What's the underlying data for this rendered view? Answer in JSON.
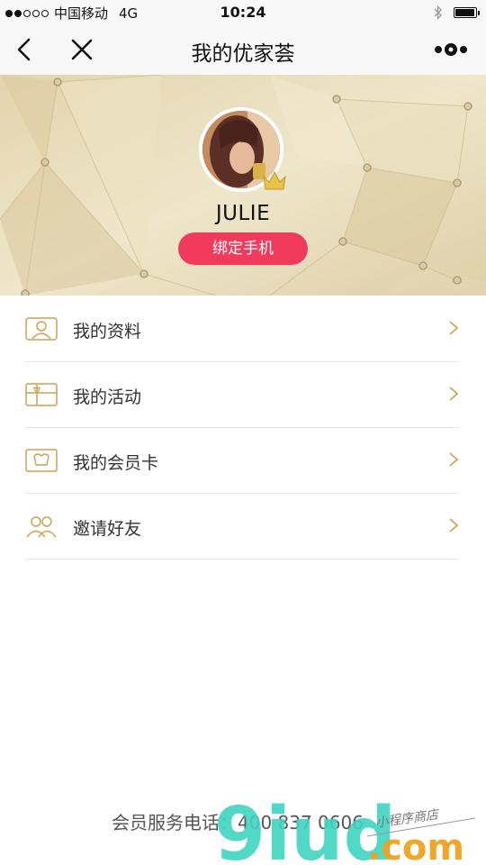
{
  "status_bar": {
    "signal": [
      true,
      true,
      false,
      false,
      false
    ],
    "carrier": "中国移动",
    "network": "4G",
    "time": "10:24",
    "battery_level": 0.95
  },
  "nav": {
    "title": "我的优家荟",
    "back_icon": "chevron-left-icon",
    "close_icon": "close-icon",
    "more_icon": "more-dots-icon"
  },
  "profile": {
    "username": "JULIE",
    "bind_phone_label": "绑定手机",
    "avatar_icon": "avatar",
    "badge_icon": "crown-icon"
  },
  "menu": {
    "items": [
      {
        "label": "我的资料",
        "icon": "id-card-icon"
      },
      {
        "label": "我的活动",
        "icon": "gift-card-icon"
      },
      {
        "label": "我的会员卡",
        "icon": "member-card-icon"
      },
      {
        "label": "邀请好友",
        "icon": "friends-icon"
      }
    ]
  },
  "footer": {
    "hotline": "会员服务电话：400 837 0606"
  },
  "watermark": {
    "brand": "9iud",
    "suffix": ".com",
    "tagline": "小程序商店"
  },
  "colors": {
    "accent": "#f23a5c",
    "gold": "#c9a352",
    "banner": "#e8dcb8"
  }
}
